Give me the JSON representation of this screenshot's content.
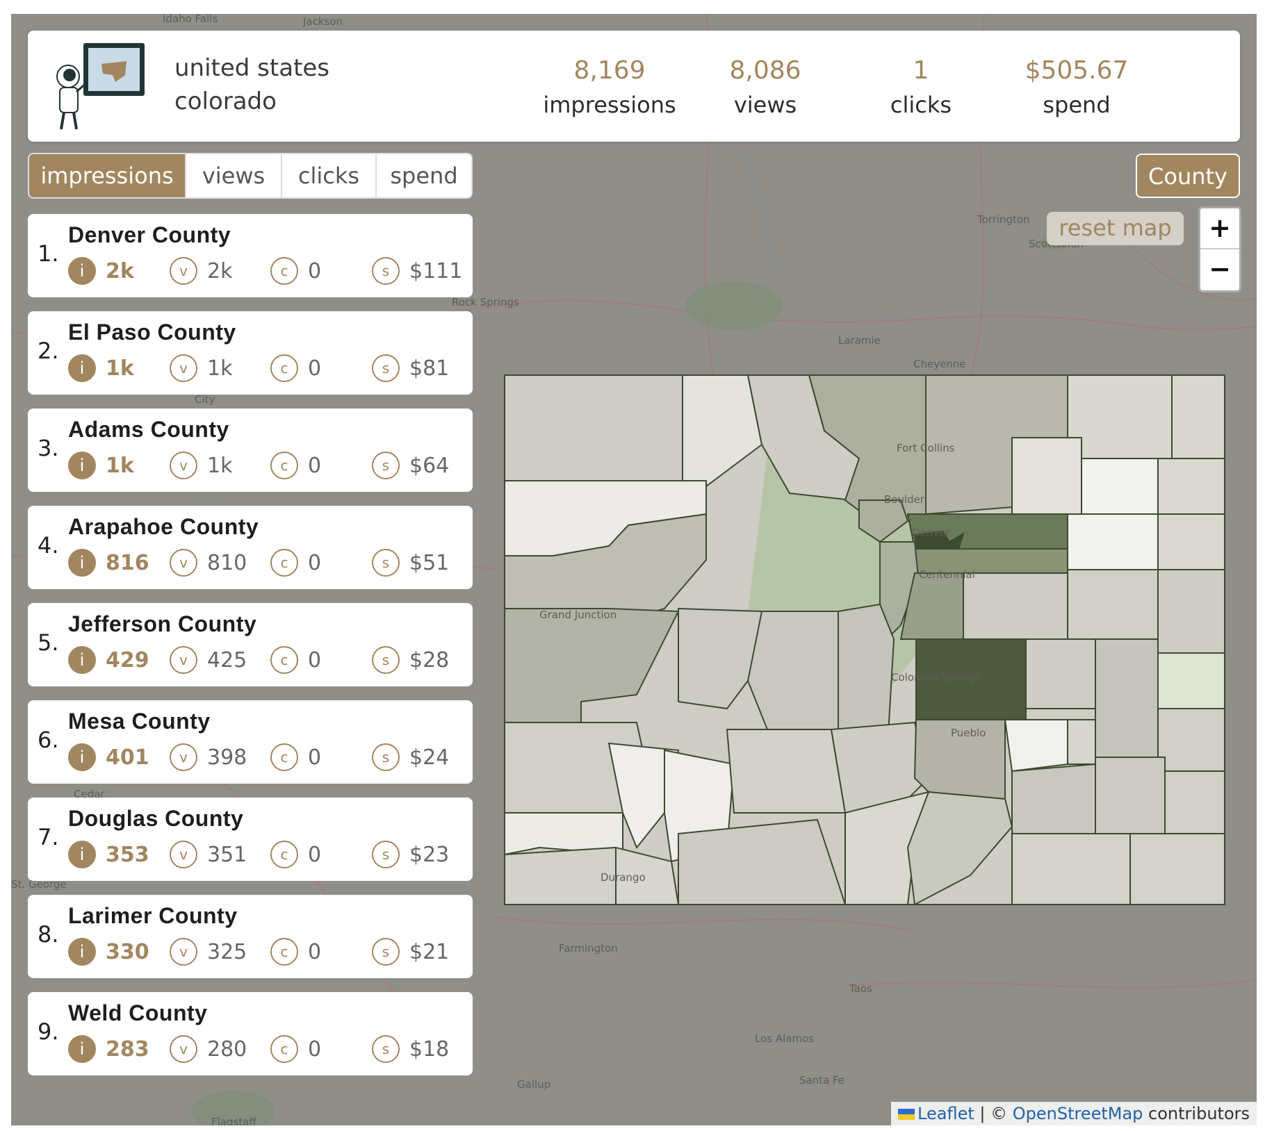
{
  "header": {
    "country": "united states",
    "state": "colorado",
    "stats": [
      {
        "value": "8,169",
        "label": "impressions"
      },
      {
        "value": "8,086",
        "label": "views"
      },
      {
        "value": "1",
        "label": "clicks"
      },
      {
        "value": "$505.67",
        "label": "spend"
      }
    ]
  },
  "metric_tabs": [
    "impressions",
    "views",
    "clicks",
    "spend"
  ],
  "active_tab": "impressions",
  "geo_level_button": "County",
  "reset_map_label": "reset map",
  "zoom": {
    "in": "+",
    "out": "−"
  },
  "metric_icons": {
    "impressions": "i",
    "views": "v",
    "clicks": "c",
    "spend": "s"
  },
  "counties": [
    {
      "rank": "1.",
      "name": "Denver County",
      "impressions": "2k",
      "views": "2k",
      "clicks": "0",
      "spend": "$111"
    },
    {
      "rank": "2.",
      "name": "El Paso County",
      "impressions": "1k",
      "views": "1k",
      "clicks": "0",
      "spend": "$81"
    },
    {
      "rank": "3.",
      "name": "Adams County",
      "impressions": "1k",
      "views": "1k",
      "clicks": "0",
      "spend": "$64"
    },
    {
      "rank": "4.",
      "name": "Arapahoe County",
      "impressions": "816",
      "views": "810",
      "clicks": "0",
      "spend": "$51"
    },
    {
      "rank": "5.",
      "name": "Jefferson County",
      "impressions": "429",
      "views": "425",
      "clicks": "0",
      "spend": "$28"
    },
    {
      "rank": "6.",
      "name": "Mesa County",
      "impressions": "401",
      "views": "398",
      "clicks": "0",
      "spend": "$24"
    },
    {
      "rank": "7.",
      "name": "Douglas County",
      "impressions": "353",
      "views": "351",
      "clicks": "0",
      "spend": "$23"
    },
    {
      "rank": "8.",
      "name": "Larimer County",
      "impressions": "330",
      "views": "325",
      "clicks": "0",
      "spend": "$21"
    },
    {
      "rank": "9.",
      "name": "Weld County",
      "impressions": "283",
      "views": "280",
      "clicks": "0",
      "spend": "$18"
    }
  ],
  "map_labels": [
    "Idaho Falls",
    "Jackson",
    "Torrington",
    "Scottsbluff",
    "Rock Springs",
    "Laramie",
    "Cheyenne",
    "Fort Collins",
    "Boulder",
    "Denver",
    "Centennial",
    "Grand Junction",
    "Colorado Springs",
    "Pueblo",
    "City",
    "Cedar",
    "St. George",
    "Durango",
    "Farmington",
    "Taos",
    "Los Alamos",
    "Santa Fe",
    "Gallup",
    "Flagstaff"
  ],
  "attribution": {
    "leaflet": "Leaflet",
    "sep": " | © ",
    "osm": "OpenStreetMap",
    "suffix": " contributors"
  },
  "colors": {
    "accent": "#a2865f",
    "map_dark": "#4a5a3a"
  }
}
